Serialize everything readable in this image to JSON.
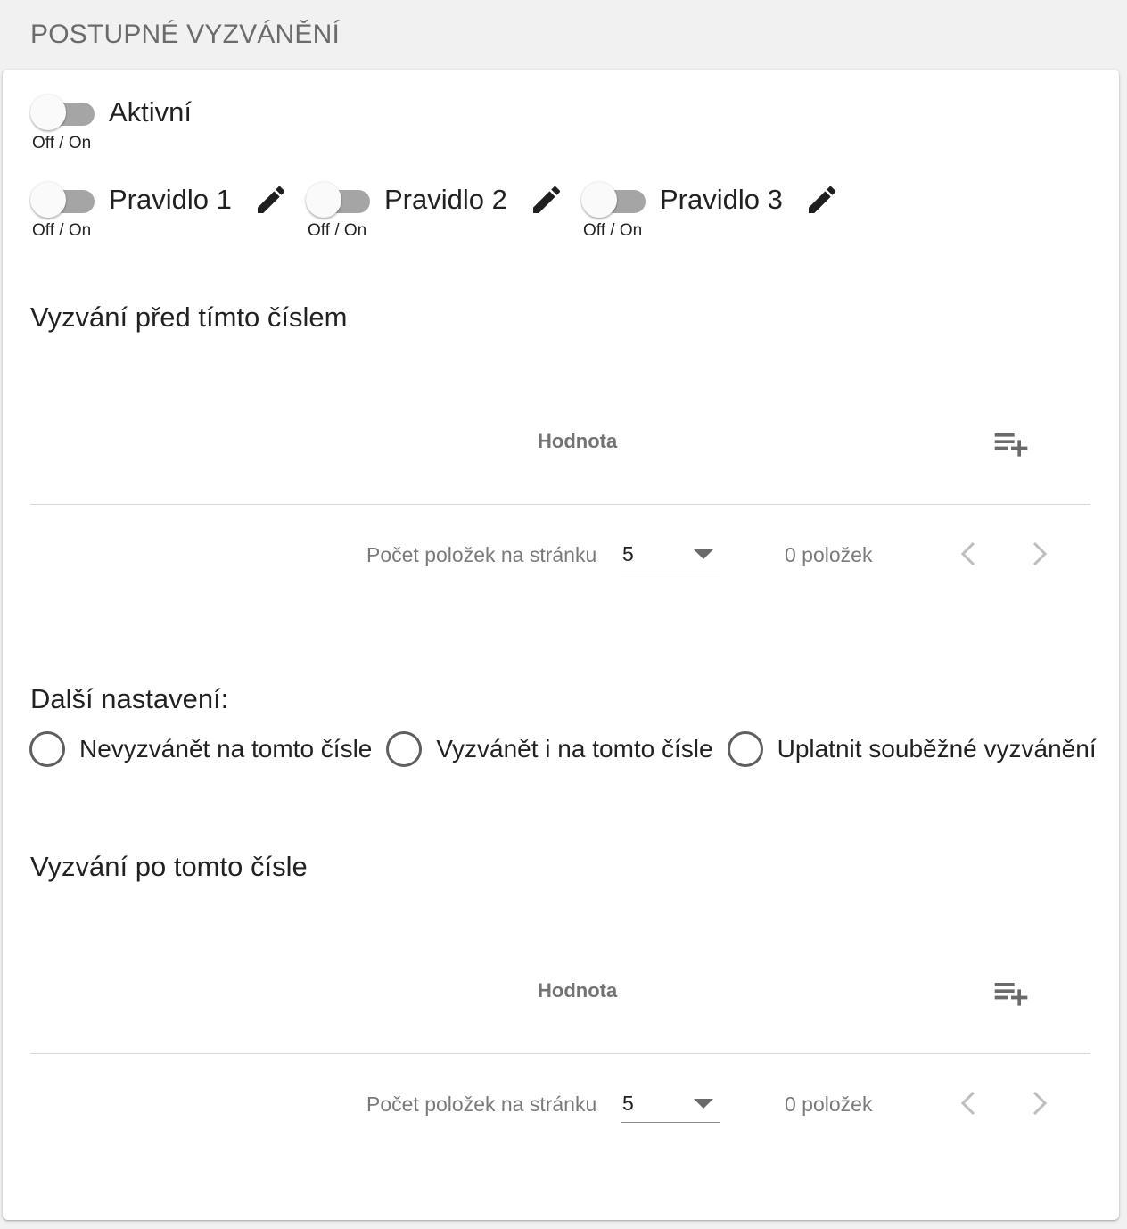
{
  "header": {
    "title": "POSTUPNÉ VYZVÁNĚNÍ"
  },
  "active_toggle": {
    "label": "Aktivní",
    "sub": "Off / On",
    "state": "off"
  },
  "rules": [
    {
      "label": "Pravidlo 1",
      "sub": "Off / On",
      "state": "off"
    },
    {
      "label": "Pravidlo 2",
      "sub": "Off / On",
      "state": "off"
    },
    {
      "label": "Pravidlo 3",
      "sub": "Off / On",
      "state": "off"
    }
  ],
  "before_section": {
    "title": "Vyzvání před tímto číslem",
    "column_header": "Hodnota",
    "add_icon": "playlist-add-icon",
    "paginator": {
      "label": "Počet položek na stránku",
      "page_size": "5",
      "range": "0 položek"
    }
  },
  "other_settings": {
    "title": "Další nastavení:",
    "options": [
      "Nevyzvánět na tomto čísle",
      "Vyzvánět i na tomto čísle",
      "Uplatnit souběžné vyzvánění"
    ]
  },
  "after_section": {
    "title": "Vyzvání po tomto čísle",
    "column_header": "Hodnota",
    "add_icon": "playlist-add-icon",
    "paginator": {
      "label": "Počet položek na stránku",
      "page_size": "5",
      "range": "0 položek"
    }
  },
  "colors": {
    "page_bg": "#f1f1f1",
    "card_bg": "#ffffff",
    "track_off": "#a5a5a5",
    "muted_text": "#737373"
  }
}
